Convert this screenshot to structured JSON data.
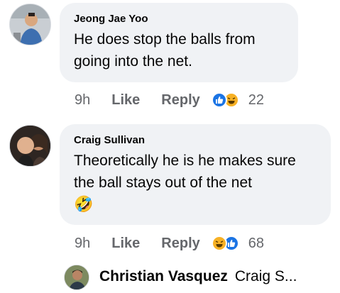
{
  "comments": [
    {
      "author": "Jeong Jae Yoo",
      "text": "He does stop the balls from going into the net.",
      "time": "9h",
      "like_label": "Like",
      "reply_label": "Reply",
      "reactions": [
        "like-icon",
        "haha-icon"
      ],
      "reaction_count": "22"
    },
    {
      "author": "Craig Sullivan",
      "text": "Theoretically he is he makes sure the ball stays out of the net",
      "emoji": "🤣",
      "time": "9h",
      "like_label": "Like",
      "reply_label": "Reply",
      "reactions": [
        "haha-icon",
        "like-icon"
      ],
      "reaction_count": "68"
    }
  ],
  "reply_preview": {
    "author": "Christian Vasquez",
    "text": "Craig S..."
  },
  "colors": {
    "bubble_bg": "#f0f2f5",
    "secondary_text": "#65676b",
    "like_blue": "#1b74e4",
    "haha_yellow": "#f7b125"
  }
}
